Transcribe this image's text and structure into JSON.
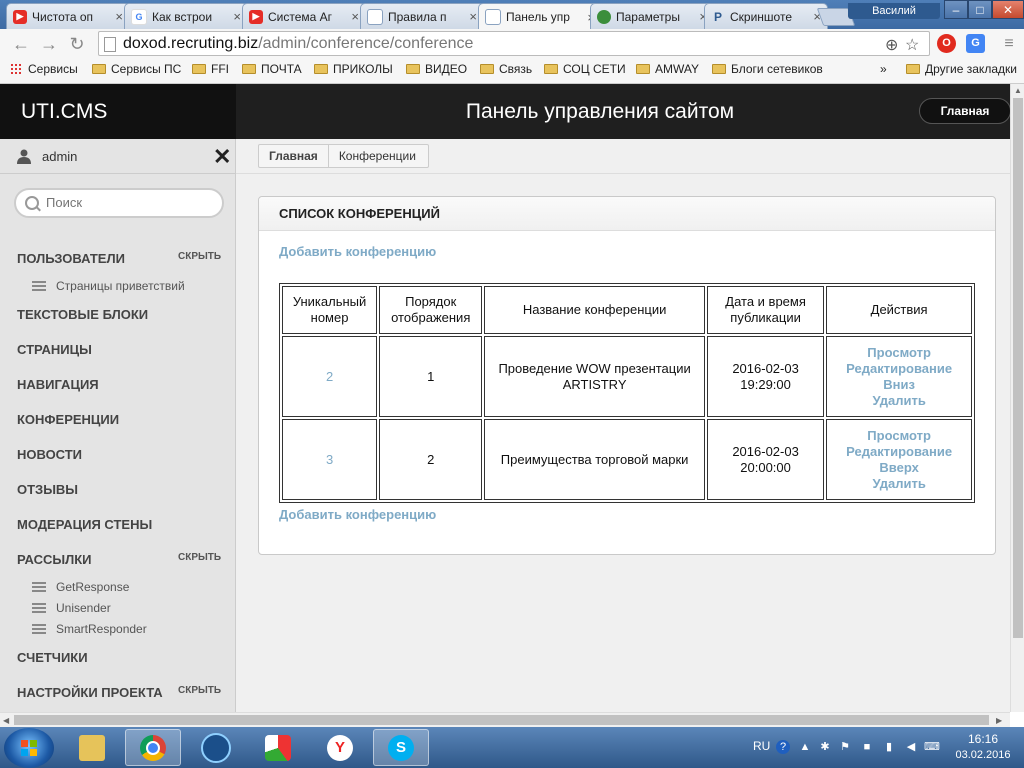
{
  "browser": {
    "tabs": [
      {
        "title": "Чистота оп",
        "icon": "youtube-icon",
        "color": "#e52d27",
        "active": false
      },
      {
        "title": "Как встрои",
        "icon": "google-icon",
        "color": "#4285f4",
        "active": false
      },
      {
        "title": "Система Аг",
        "icon": "youtube-icon",
        "color": "#e52d27",
        "active": false
      },
      {
        "title": "Правила п",
        "icon": "document-icon",
        "color": "#8aa2c0",
        "active": false
      },
      {
        "title": "Панель упр",
        "icon": "document-icon",
        "color": "#8aa2c0",
        "active": true
      },
      {
        "title": "Параметры",
        "icon": "chrome-settings-icon",
        "color": "#3b8e3b",
        "active": false
      },
      {
        "title": "Скриншоте",
        "icon": "p-icon",
        "color": "#2e5a8f",
        "active": false
      }
    ],
    "user_label": "Василий",
    "url_domain": "doxod.recruting.biz",
    "url_path": "/admin/conference/conference",
    "bookmarks": [
      {
        "label": "Сервисы",
        "type": "apps"
      },
      {
        "label": "Сервисы ПС",
        "type": "folder"
      },
      {
        "label": "FFI",
        "type": "folder"
      },
      {
        "label": "ПОЧТА",
        "type": "folder"
      },
      {
        "label": "ПРИКОЛЫ",
        "type": "folder"
      },
      {
        "label": "ВИДЕО",
        "type": "folder"
      },
      {
        "label": "Связь",
        "type": "folder"
      },
      {
        "label": "СОЦ СЕТИ",
        "type": "folder"
      },
      {
        "label": "AMWAY",
        "type": "folder"
      },
      {
        "label": "Блоги сетевиков",
        "type": "folder"
      }
    ],
    "bookmarks_more": "»",
    "other_bookmarks": "Другие закладки"
  },
  "header": {
    "brand": "UTI.CMS",
    "title": "Панель управления сайтом",
    "home_button": "Главная"
  },
  "sidebar": {
    "username": "admin",
    "search_placeholder": "Поиск",
    "items": [
      {
        "label": "Пользователи",
        "hide": "СКРЫТЬ",
        "children": [
          "Страницы приветствий"
        ]
      },
      {
        "label": "Текстовые блоки"
      },
      {
        "label": "Страницы"
      },
      {
        "label": "Навигация"
      },
      {
        "label": "Конференции"
      },
      {
        "label": "Новости"
      },
      {
        "label": "Отзывы"
      },
      {
        "label": "Модерация стены"
      },
      {
        "label": "Рассылки",
        "hide": "СКРЫТЬ",
        "children": [
          "GetResponse",
          "Unisender",
          "SmartResponder"
        ]
      },
      {
        "label": "Счетчики"
      },
      {
        "label": "Настройки проекта",
        "hide": "СКРЫТЬ"
      }
    ]
  },
  "breadcrumb": {
    "home": "Главная",
    "current": "Конференции"
  },
  "panel": {
    "title": "СПИСОК КОНФЕРЕНЦИЙ",
    "add_link": "Добавить конференцию",
    "columns": [
      "Уникальный номер",
      "Порядок отображения",
      "Название конференции",
      "Дата и время публикации",
      "Действия"
    ],
    "rows": [
      {
        "id": "2",
        "order": "1",
        "name": "Проведение WOW презентации ARTISTRY",
        "date": "2016-02-03",
        "time": "19:29:00",
        "actions": [
          "Просмотр",
          "Редактирование",
          "Вниз",
          "Удалить"
        ]
      },
      {
        "id": "3",
        "order": "2",
        "name": "Преимущества торговой марки",
        "date": "2016-02-03",
        "time": "20:00:00",
        "actions": [
          "Просмотр",
          "Редактирование",
          "Вверх",
          "Удалить"
        ]
      }
    ]
  },
  "taskbar": {
    "lang": "RU",
    "time": "16:16",
    "date": "03.02.2016"
  },
  "colors": {
    "link": "#7faac6",
    "header_bg": "#1f1f1f",
    "sidebar_bg": "#e4e4e4"
  }
}
